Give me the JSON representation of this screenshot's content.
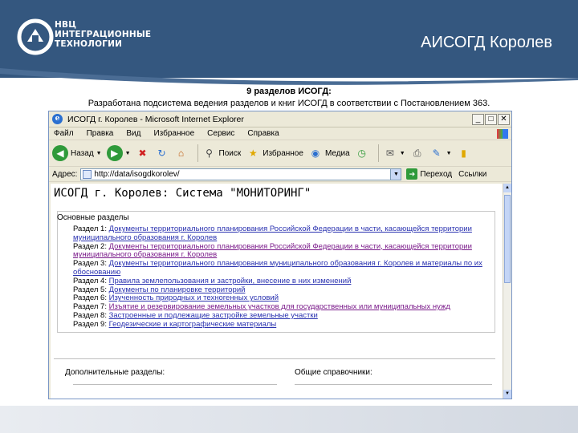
{
  "slide": {
    "brand_line1": "НВЦ",
    "brand_line2": "ИНТЕГРАЦИОННЫЕ",
    "brand_line3": "ТЕХНОЛОГИИ",
    "title": "АИСОГД Королев",
    "caption_bold": "9 разделов ИСОГД:",
    "caption_text": "Разработана подсистема ведения разделов и книг ИСОГД в соответствии с Постановлением  363.",
    "colors": {
      "band": "#34577f",
      "link": "#2a32b0",
      "visited": "#7a1a8a"
    }
  },
  "browser": {
    "title": "ИСОГД г. Королев - Microsoft Internet Explorer",
    "window_buttons": [
      "_",
      "□",
      "✕"
    ],
    "menu": [
      "Файл",
      "Правка",
      "Вид",
      "Избранное",
      "Сервис",
      "Справка"
    ],
    "toolbar": {
      "back": "Назад",
      "search": "Поиск",
      "favorites": "Избранное",
      "media": "Медиа"
    },
    "address_label": "Адрес:",
    "address_value": "http://data/isogdkorolev/",
    "go_label": "Переход",
    "links_label": "Ссылки"
  },
  "page": {
    "heading": "ИСОГД г. Королев: Система \"МОНИТОРИНГ\"",
    "main_sections_label": "Основные разделы",
    "sections": [
      {
        "label": "Раздел 1:",
        "link": "Документы территориального планирования Российской Федерации в части, касающейся территории муниципального образования  г. Королев"
      },
      {
        "label": "Раздел 2:",
        "link": "Документы территориального планирования Российской Федерации в части, касающейся территории муниципального образования  г. Королев"
      },
      {
        "label": "Раздел 3:",
        "link": "Документы территориального планирования муниципального образования г. Королев и материалы по их обоснованию"
      },
      {
        "label": "Раздел 4:",
        "link": "Правила землепользования и застройки, внесение в них изменений"
      },
      {
        "label": "Раздел 5:",
        "link": "Документы по планировке территорий"
      },
      {
        "label": "Раздел 6:",
        "link": "Изученность природных и техногенных условий"
      },
      {
        "label": "Раздел 7:",
        "link": "Изъятие и резервирование земельных участков для государственных или муниципальных нужд"
      },
      {
        "label": "Раздел 8:",
        "link": "Застроенные и подлежащие застройке земельные участки"
      },
      {
        "label": "Раздел 9:",
        "link": "Геодезические и картографические материалы"
      }
    ],
    "additional_label": "Дополнительные разделы:",
    "references_label": "Общие справочники:"
  }
}
